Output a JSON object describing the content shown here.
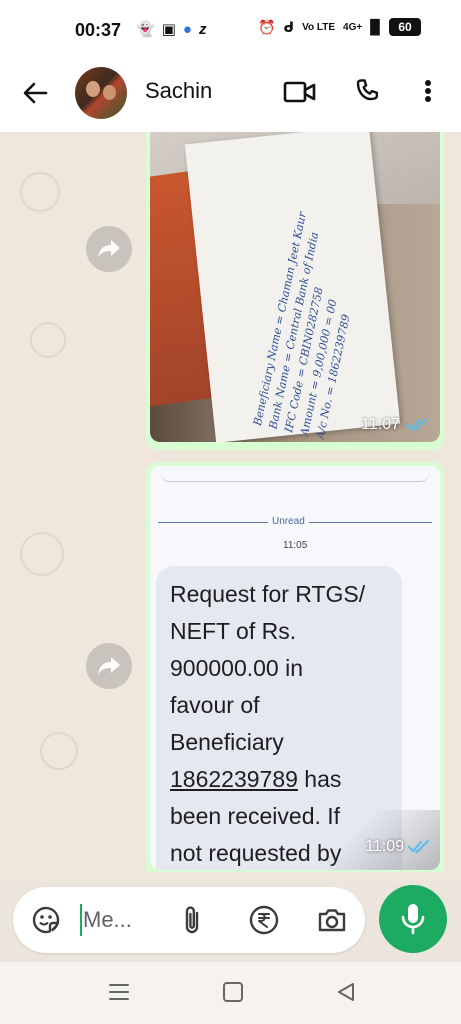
{
  "status_bar": {
    "time": "00:37",
    "left_icons": [
      "snapchat-icon",
      "instagram-icon",
      "messenger-icon",
      "z-icon"
    ],
    "z_glyph": "z",
    "network": "Vo LTE",
    "signal": "4G+",
    "battery": "60"
  },
  "header": {
    "contact_name": "Sachin"
  },
  "messages": [
    {
      "type": "image",
      "time": "11:07",
      "status": "read",
      "paper_text": [
        "Beneficiary Name = Chaman Jeet Kaur",
        "Bank Name = Central Bank of India",
        "IFC Code = CBIN0282758",
        "Amount = 9,00,000 = 00",
        "A/c No. = 1862239789"
      ]
    },
    {
      "type": "screenshot",
      "time": "11:09",
      "status": "read",
      "unread_label": "Unread",
      "inner_time": "11:05",
      "sms_lines": [
        "Request for RTGS/",
        "NEFT of Rs.",
        "900000.00 in",
        "favour of",
        "Beneficiary"
      ],
      "sms_link": "1862239789",
      "sms_after_link": " has",
      "sms_tail": [
        "been received. If",
        "not requested by"
      ]
    }
  ],
  "composer": {
    "placeholder": "Me..."
  },
  "colors": {
    "accent": "#1daa61",
    "bubble_out": "#d9fdd3",
    "tick_blue": "#53bdeb"
  }
}
